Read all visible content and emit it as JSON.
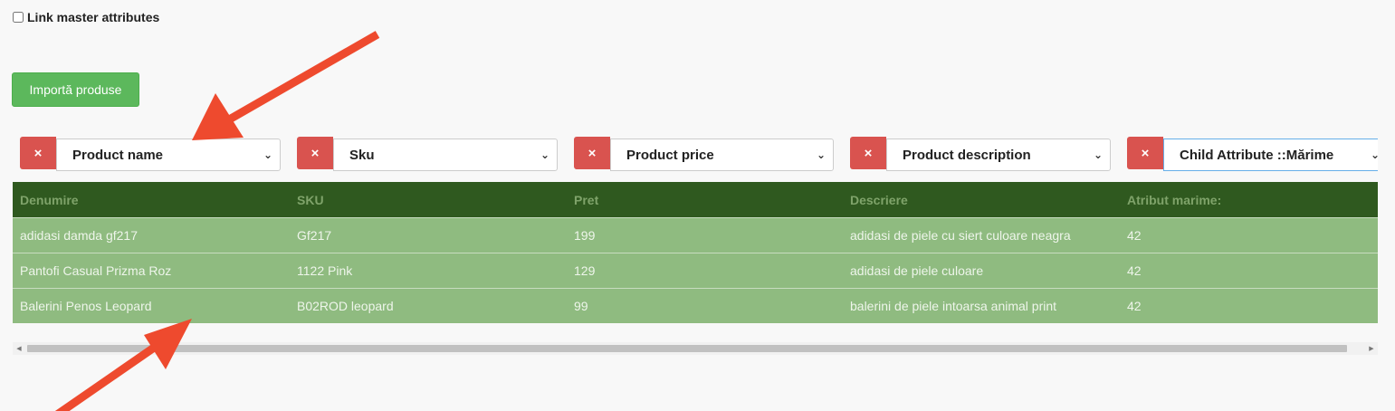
{
  "link_master": {
    "label": "Link master attributes",
    "checked": false
  },
  "import_button": {
    "label": "Importă produse"
  },
  "mappers": [
    {
      "value": "Product name"
    },
    {
      "value": "Sku"
    },
    {
      "value": "Product price"
    },
    {
      "value": "Product description"
    },
    {
      "value": "Child Attribute ::Mărime"
    }
  ],
  "table": {
    "headers": [
      "Denumire",
      "SKU",
      "Pret",
      "Descriere",
      "Atribut marime:"
    ],
    "rows": [
      [
        "adidasi damda gf217",
        "Gf217",
        "199",
        "adidasi de piele cu siert culoare neagra",
        "42"
      ],
      [
        "Pantofi Casual Prizma Roz",
        "1122 Pink",
        "129",
        "adidasi de piele culoare",
        "42"
      ],
      [
        "Balerini Penos Leopard",
        "B02ROD leopard",
        "99",
        "balerini de piele intoarsa animal print",
        "42"
      ]
    ]
  },
  "icons": {
    "remove": "×",
    "chevron": "⌄",
    "scroll_left": "◀",
    "scroll_right": "▶"
  },
  "colors": {
    "import_button": "#5cb85c",
    "remove_button": "#d9534f",
    "table_header": "#2f591f",
    "table_row": "#8fbb80",
    "annotation_arrow": "#ee4a2e"
  }
}
